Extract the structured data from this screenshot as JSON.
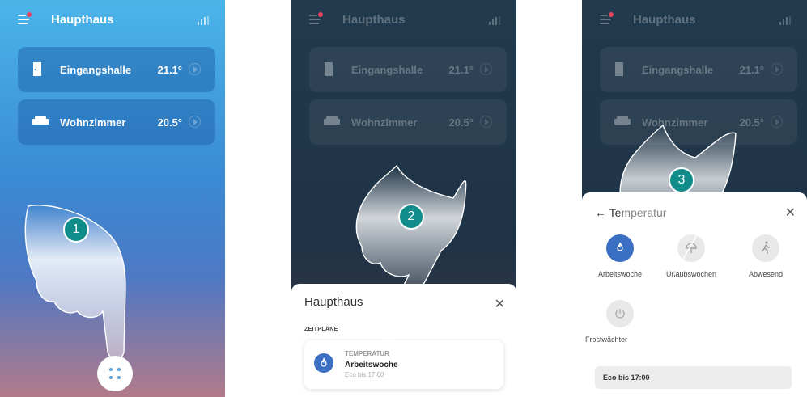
{
  "app": {
    "title": "Haupthaus"
  },
  "rooms": [
    {
      "name": "Eingangshalle",
      "temp": "21.1°"
    },
    {
      "name": "Wohnzimmer",
      "temp": "20.5°"
    }
  ],
  "steps": [
    "1",
    "2",
    "3"
  ],
  "sheet_schedules": {
    "title": "Haupthaus",
    "section": "ZEITPLÄNE",
    "card": {
      "category": "TEMPERATUR",
      "name": "Arbeitswoche",
      "detail": "Eco bis 17:00"
    }
  },
  "sheet_temperature": {
    "title": "Temperatur",
    "modes": [
      {
        "label": "Arbeitswoche",
        "icon": "flame-icon",
        "active": true
      },
      {
        "label": "Urlaubswochen",
        "icon": "umbrella-icon",
        "active": false
      },
      {
        "label": "Abwesend",
        "icon": "walking-person-icon",
        "active": false
      },
      {
        "label": "Frostwächter",
        "icon": "power-icon",
        "active": false
      }
    ],
    "status": "Eco bis 17:00"
  },
  "colors": {
    "accent": "#3a6fc4",
    "step_badge": "#108c8a",
    "alert_dot": "#e8425a"
  }
}
